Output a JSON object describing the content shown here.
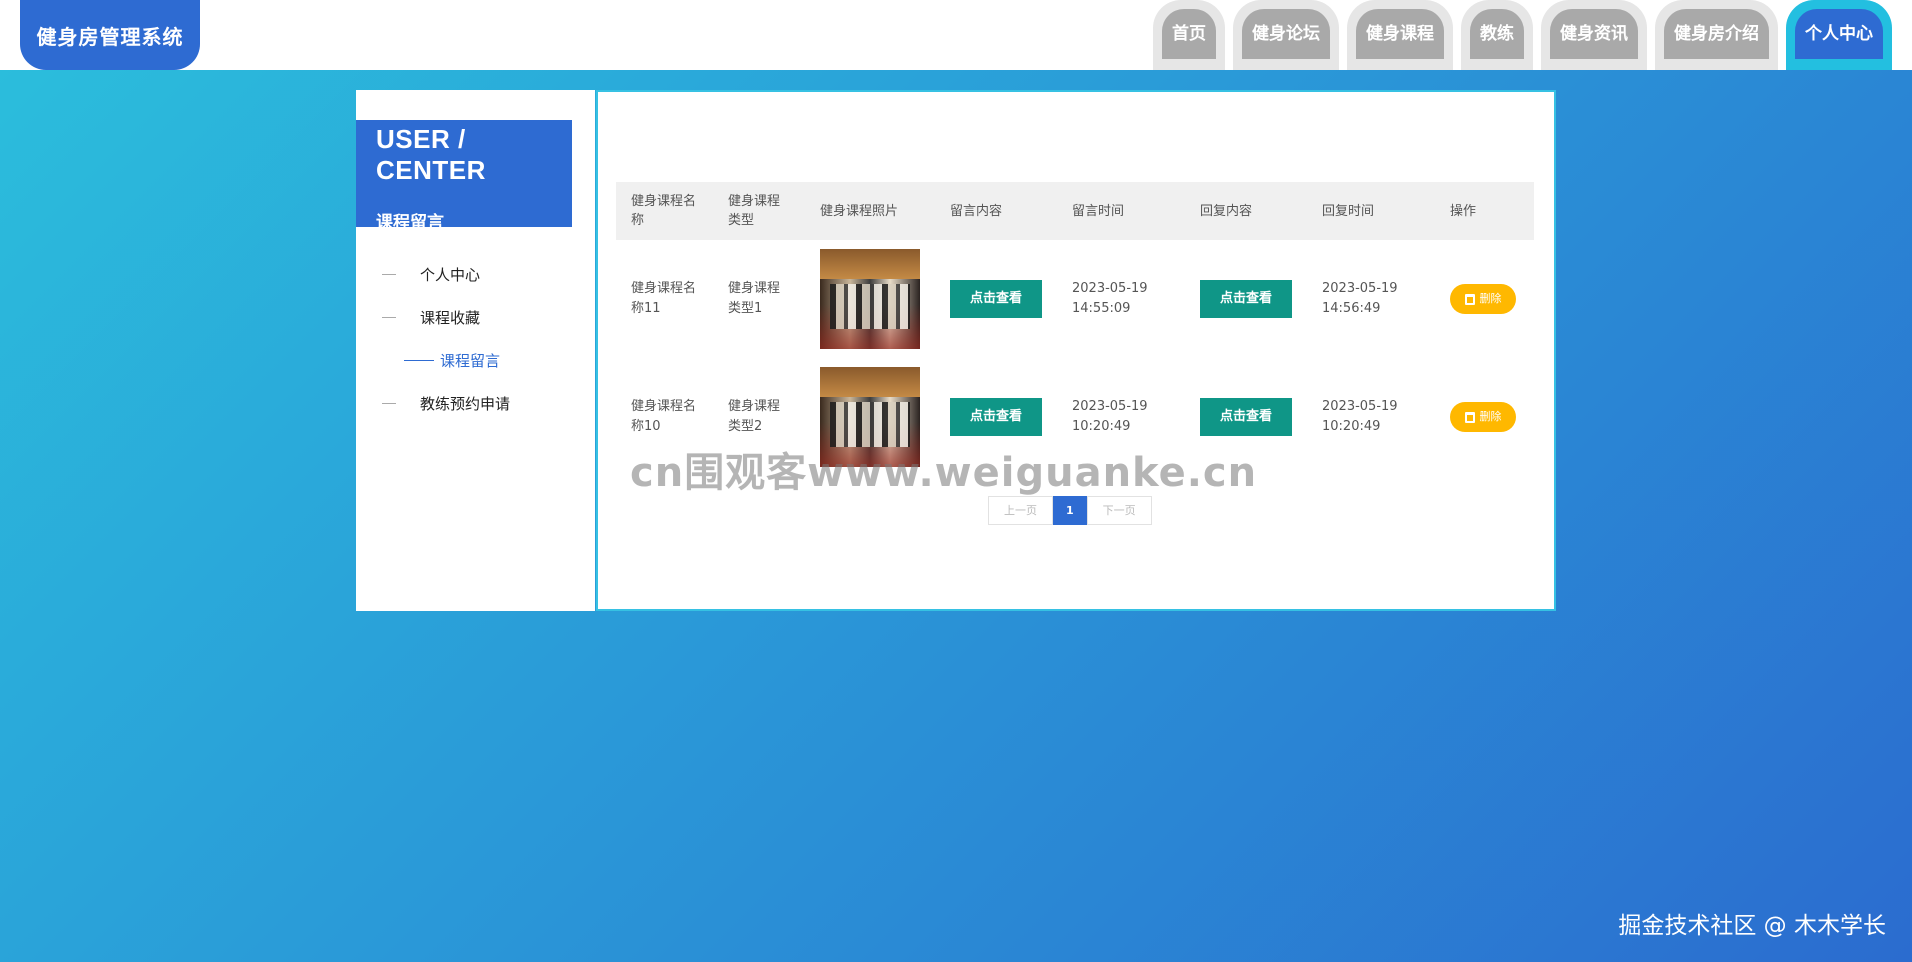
{
  "brand": "健身房管理系统",
  "nav": [
    "首页",
    "健身论坛",
    "健身课程",
    "教练",
    "健身资讯",
    "健身房介绍",
    "个人中心"
  ],
  "nav_active": "个人中心",
  "sidebar": {
    "title_en": "USER / CENTER",
    "title_cn": "课程留言",
    "items": [
      {
        "label": "个人中心",
        "active": false
      },
      {
        "label": "课程收藏",
        "active": false
      },
      {
        "label": "课程留言",
        "active": true
      },
      {
        "label": "教练预约申请",
        "active": false
      }
    ]
  },
  "table": {
    "headers": [
      "健身课程名称",
      "健身课程类型",
      "健身课程照片",
      "留言内容",
      "留言时间",
      "回复内容",
      "回复时间",
      "操作"
    ],
    "rows": [
      {
        "name": "健身课程名称11",
        "type": "健身课程类型1",
        "content_btn": "点击查看",
        "msg_time": "2023-05-19 14:55:09",
        "reply_btn": "点击查看",
        "reply_time": "2023-05-19 14:56:49",
        "delete": "删除"
      },
      {
        "name": "健身课程名称10",
        "type": "健身课程类型2",
        "content_btn": "点击查看",
        "msg_time": "2023-05-19 10:20:49",
        "reply_btn": "点击查看",
        "reply_time": "2023-05-19 10:20:49",
        "delete": "删除"
      }
    ]
  },
  "pager": {
    "prev": "上一页",
    "current": "1",
    "next": "下一页"
  },
  "watermark": "cn围观客www.weiguanke.cn",
  "credit": "掘金技术社区 @ 木木学长"
}
